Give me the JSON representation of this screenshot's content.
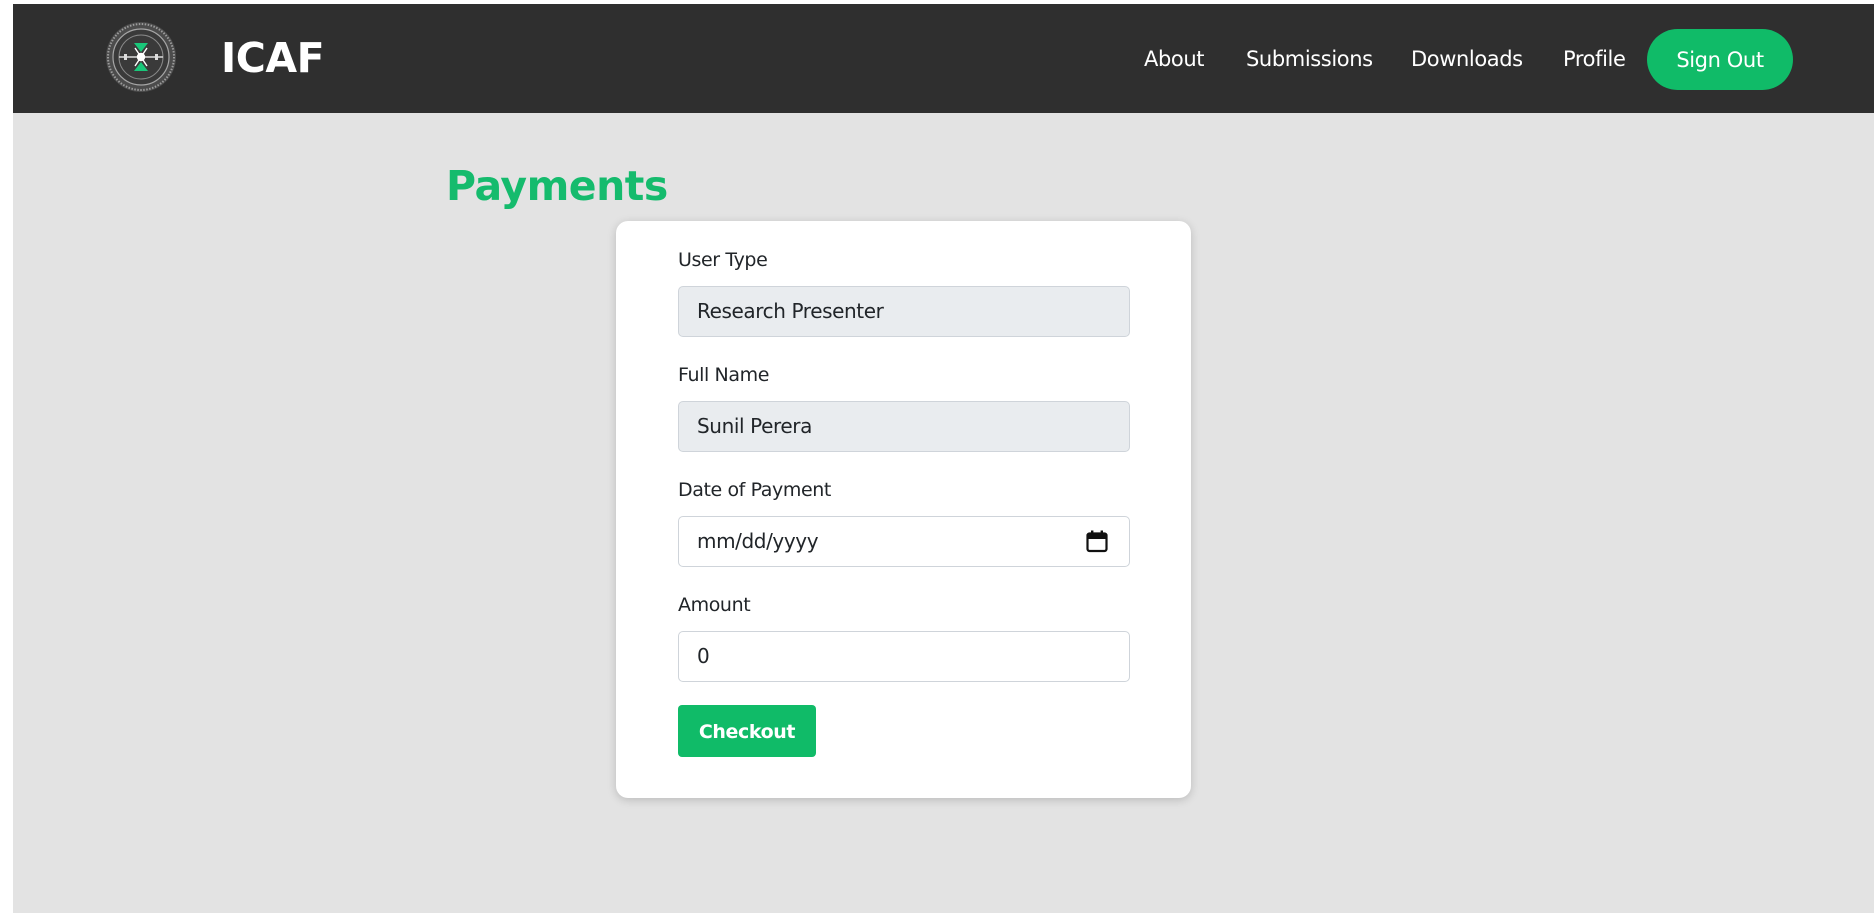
{
  "navbar": {
    "brand": "ICAF",
    "logo_icon": "gear-emblem-icon",
    "links": [
      {
        "label": "About"
      },
      {
        "label": "Submissions"
      },
      {
        "label": "Downloads"
      },
      {
        "label": "Profile"
      }
    ],
    "sign_out_label": "Sign Out",
    "background_color": "#2f2f2f",
    "accent_color": "#10bb68"
  },
  "page": {
    "title": "Payments",
    "background_color": "#e3e3e3",
    "title_color": "#15bb6d"
  },
  "form": {
    "user_type": {
      "label": "User Type",
      "value": "Research Presenter"
    },
    "full_name": {
      "label": "Full Name",
      "value": "Sunil Perera"
    },
    "payment_date": {
      "label": "Date of Payment",
      "placeholder": "mm/dd/yyyy",
      "icon": "calendar-icon"
    },
    "amount": {
      "label": "Amount",
      "value": "0"
    },
    "checkout_label": "Checkout"
  }
}
